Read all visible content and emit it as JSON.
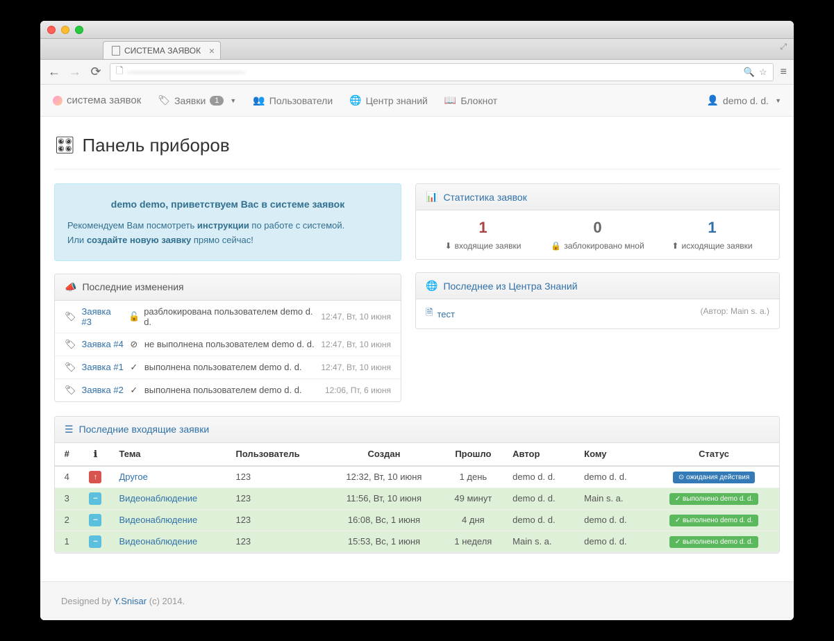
{
  "browser": {
    "tab_title": "СИСТЕМА ЗАЯВОК",
    "url_blurred": "—————————————"
  },
  "nav": {
    "brand": "система заявок",
    "tickets": "Заявки",
    "tickets_badge": "1",
    "users": "Пользователи",
    "kb": "Центр знаний",
    "notepad": "Блокнот",
    "user": "demo d. d."
  },
  "page_title": "Панель приборов",
  "welcome": {
    "title": "demo demo, приветствуем Вас в системе заявок",
    "line1_a": "Рекомендуем Вам посмотреть ",
    "line1_b": "инструкции",
    "line1_c": " по работе   с системой.",
    "line2_a": "Или ",
    "line2_b": "создайте новую заявку",
    "line2_c": " прямо сейчас!"
  },
  "stats": {
    "heading": "Статистика заявок",
    "items": [
      {
        "value": "1",
        "label": "входящие заявки",
        "color": "red"
      },
      {
        "value": "0",
        "label": "заблокировано мной",
        "color": "gray"
      },
      {
        "value": "1",
        "label": "исходящие заявки",
        "color": "blue"
      }
    ]
  },
  "changes": {
    "heading": "Последние изменения",
    "rows": [
      {
        "link": "Заявка #3",
        "icon": "🔓",
        "text": "разблокирована пользователем demo d. d.",
        "time": "12:47, Вт, 10 июня"
      },
      {
        "link": "Заявка #4",
        "icon": "⊘",
        "text": "не выполнена пользователем demo d. d.",
        "time": "12:47, Вт, 10 июня"
      },
      {
        "link": "Заявка #1",
        "icon": "✓",
        "text": "выполнена пользователем demo d. d.",
        "time": "12:47, Вт, 10 июня"
      },
      {
        "link": "Заявка #2",
        "icon": "✓",
        "text": "выполнена пользователем demo d. d.",
        "time": "12:06, Пт, 6 июня"
      }
    ]
  },
  "kb": {
    "heading": "Последнее из Центра Знаний",
    "item_link": "тест",
    "item_author": "(Автор: Main s. a.)"
  },
  "incoming": {
    "heading": "Последние входящие заявки",
    "headers": {
      "num": "#",
      "info": "ℹ",
      "topic": "Тема",
      "user": "Пользователь",
      "created": "Создан",
      "elapsed": "Прошло",
      "author": "Автор",
      "to": "Кому",
      "status": "Статус"
    },
    "rows": [
      {
        "n": "4",
        "prio": "↑",
        "prio_cls": "prio-red",
        "topic": "Другое",
        "user": "123",
        "created": "12:32, Вт, 10 июня",
        "elapsed": "1 день",
        "author": "demo d. d.",
        "to": "demo d. d.",
        "status": "⊙ ожидания действия",
        "status_cls": "sb-blue",
        "row_cls": ""
      },
      {
        "n": "3",
        "prio": "−",
        "prio_cls": "prio-blue",
        "topic": "Видеонаблюдение",
        "user": "123",
        "created": "11:56, Вт, 10 июня",
        "elapsed": "49 минут",
        "author": "demo d. d.",
        "to": "Main s. a.",
        "status": "✓ выполнено demo d. d.",
        "status_cls": "sb-green",
        "row_cls": "green-row"
      },
      {
        "n": "2",
        "prio": "−",
        "prio_cls": "prio-blue",
        "topic": "Видеонаблюдение",
        "user": "123",
        "created": "16:08, Вс, 1 июня",
        "elapsed": "4 дня",
        "author": "demo d. d.",
        "to": "demo d. d.",
        "status": "✓ выполнено demo d. d.",
        "status_cls": "sb-green",
        "row_cls": "green-row"
      },
      {
        "n": "1",
        "prio": "−",
        "prio_cls": "prio-blue",
        "topic": "Видеонаблюдение",
        "user": "123",
        "created": "15:53, Вс, 1 июня",
        "elapsed": "1 неделя",
        "author": "Main s. a.",
        "to": "demo d. d.",
        "status": "✓ выполнено demo d. d.",
        "status_cls": "sb-green",
        "row_cls": "green-row"
      }
    ]
  },
  "footer": {
    "pre": "Designed by ",
    "link": "Y.Snisar",
    "post": " (c) 2014."
  }
}
